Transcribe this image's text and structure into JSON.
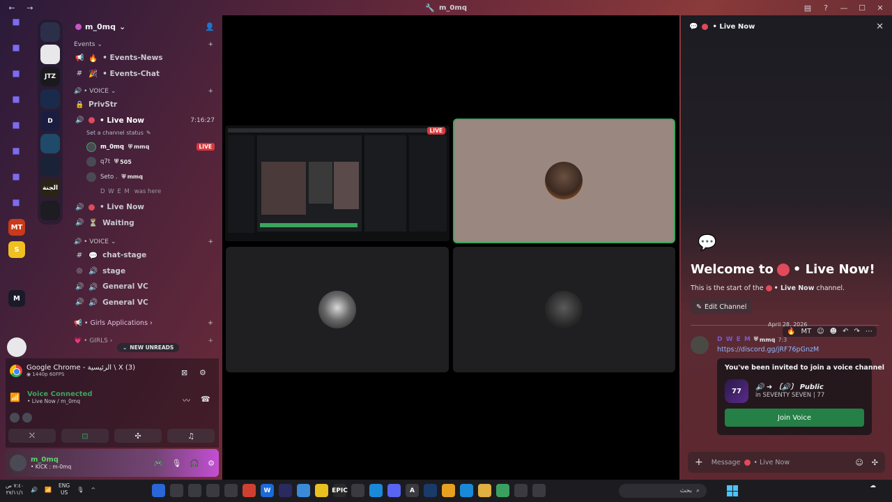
{
  "window": {
    "title": "m_0mq"
  },
  "server_rail": {
    "folders": [
      "folder-icon",
      "folder-icon",
      "folder-icon",
      "folder-icon",
      "folder-icon",
      "folder-icon",
      "folder-icon",
      "folder-icon",
      "folder-icon"
    ],
    "group_servers": [
      {
        "label": "",
        "color": "#2b2f4a"
      },
      {
        "label": "",
        "color": "#e8e8ea"
      },
      {
        "label": "JTZ",
        "color": "#1a1a1e"
      },
      {
        "label": "",
        "color": "#1a2a4a"
      },
      {
        "label": "D",
        "color": "#1a1d40"
      },
      {
        "label": "",
        "color": "#1f4a6a"
      },
      {
        "label": "",
        "color": "#1a2238"
      },
      {
        "label": "الجنة",
        "color": "#2a2418"
      },
      {
        "label": "",
        "color": "#1c1c22"
      }
    ],
    "loose_servers": [
      {
        "label": "MT",
        "color": "#c83a1a"
      },
      {
        "label": "S",
        "color": "#f0c020"
      },
      {
        "label": "M",
        "color": "#1a1a2a"
      }
    ]
  },
  "guild": {
    "name": "m_0mq",
    "events_category": "Events",
    "events_channels": [
      {
        "name": "Events-News",
        "prefix": "•"
      },
      {
        "name": "Events-Chat",
        "prefix": "•"
      }
    ],
    "voice_category_1": "VOICE",
    "voice_channels_1": [
      {
        "name": "PrivStr"
      },
      {
        "name": "• Live Now",
        "time": "7:16:27",
        "status_hint": "Set a channel status"
      },
      {
        "name": "• Live Now"
      },
      {
        "name": "Waiting"
      }
    ],
    "members": [
      {
        "name": "m_0mq",
        "tag": "mmq",
        "live": "LIVE"
      },
      {
        "name": "q7t",
        "tag": "505"
      },
      {
        "name": "Seto .",
        "tag": "mmq"
      },
      {
        "name": "D W E M",
        "note": "was here"
      }
    ],
    "voice_category_2": "VOICE",
    "voice_channels_2": [
      {
        "name": "chat-stage",
        "kind": "text"
      },
      {
        "name": "stage",
        "kind": "stage"
      },
      {
        "name": "General VC",
        "kind": "voice"
      },
      {
        "name": "General VC",
        "kind": "voice"
      }
    ],
    "girls_applications": "Girls Applications",
    "girls_category": "GIRLS",
    "new_unreads": "NEW UNREADS"
  },
  "voice_panel": {
    "stream_title": "Google Chrome - الرئيسية \\ X (3)",
    "stream_quality": "1440p 60FPS",
    "voice_connected": "Voice Connected",
    "voice_location": "• Live Now / m_0mq"
  },
  "user": {
    "name": "m_0mq",
    "status": "• KICK : m-0mq"
  },
  "stage": {
    "live_label": "LIVE"
  },
  "chat": {
    "header": "• Live Now",
    "welcome_prefix": "Welcome to",
    "welcome_suffix": "• Live Now!",
    "start_prefix": "This is the start of the",
    "start_channel": "• Live Now",
    "start_suffix": "channel.",
    "edit_channel": "Edit Channel",
    "date": "April 28, 2026",
    "message": {
      "author": "D W E M",
      "tag": "mmq",
      "time": "7:3",
      "link": "https://discord.gg/jRF76pGnzM"
    },
    "invite": {
      "title": "You've been invited to join a voice channel",
      "channel": "🔊 ➜ 〔🔊〕 Public",
      "server": "in SEVENTY SEVEN | 77",
      "icon_label": "77",
      "join": "Join Voice"
    },
    "composer_placeholder": "Message",
    "composer_channel": "• Live Now"
  },
  "taskbar": {
    "time": "٧:٤٠ ص",
    "date": "٢٧/١١/١",
    "lang_1": "ENG",
    "lang_2": "US",
    "search": "بحث",
    "apps": [
      {
        "label": "",
        "color": "#2a66d8"
      },
      {
        "label": "",
        "color": "#3a3a40"
      },
      {
        "label": "",
        "color": "#3a3a40"
      },
      {
        "label": "",
        "color": "#3a3a40"
      },
      {
        "label": "",
        "color": "#3a3a40"
      },
      {
        "label": "",
        "color": "#d04030"
      },
      {
        "label": "W",
        "color": "#1a6ad8"
      },
      {
        "label": "",
        "color": "#2a2a60"
      },
      {
        "label": "",
        "color": "#3a8ad8"
      },
      {
        "label": "",
        "color": "#e8c020"
      },
      {
        "label": "EPIC",
        "color": "#2a2a2a"
      },
      {
        "label": "",
        "color": "#3a3a40"
      },
      {
        "label": "",
        "color": "#1a8ad8"
      },
      {
        "label": "",
        "color": "#5865f2"
      },
      {
        "label": "A",
        "color": "#3a3a40"
      },
      {
        "label": "",
        "color": "#1a3a6a"
      },
      {
        "label": "",
        "color": "#e8a020"
      },
      {
        "label": "",
        "color": "#1a8ad8"
      },
      {
        "label": "",
        "color": "#e0b040"
      },
      {
        "label": "",
        "color": "#3aa060"
      },
      {
        "label": "",
        "color": "#3a3a40"
      },
      {
        "label": "",
        "color": "#3a3a40"
      }
    ]
  }
}
